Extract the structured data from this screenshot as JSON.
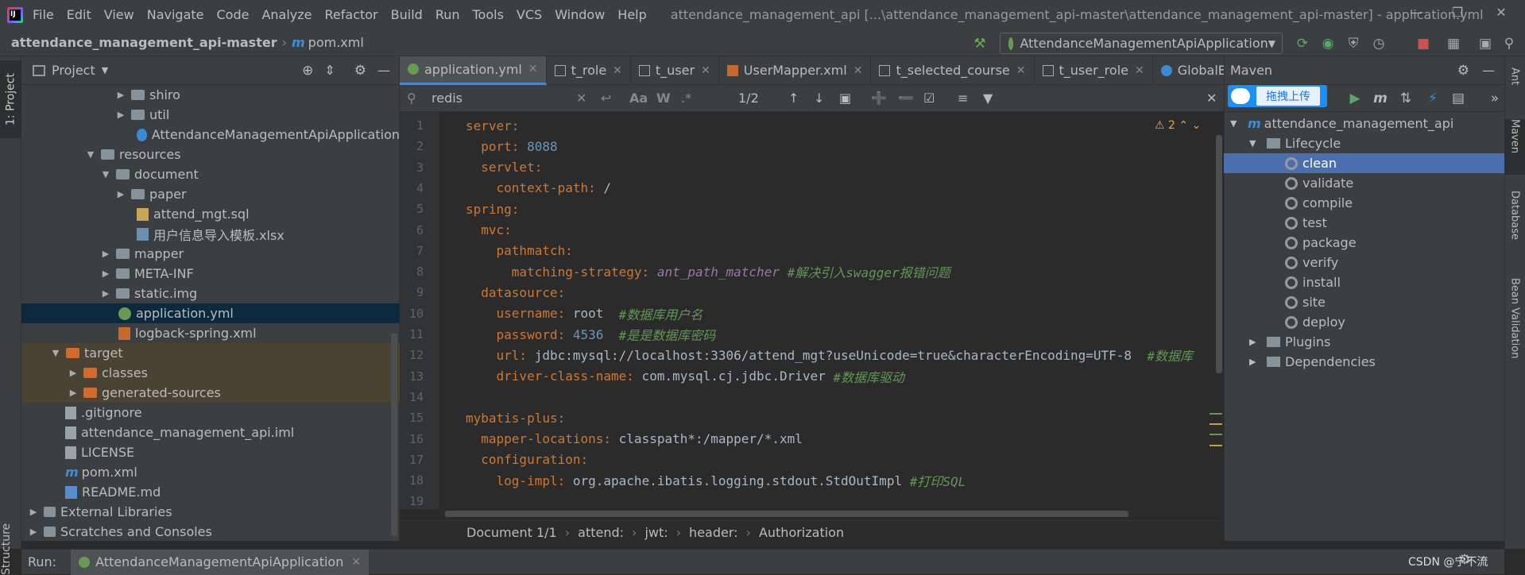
{
  "menubar": {
    "items": [
      "File",
      "Edit",
      "View",
      "Navigate",
      "Code",
      "Analyze",
      "Refactor",
      "Build",
      "Run",
      "Tools",
      "VCS",
      "Window",
      "Help"
    ],
    "window_title": "attendance_management_api [...\\attendance_management_api-master\\attendance_management_api-master] - application.yml"
  },
  "navbar": {
    "project": "attendance_management_api-master",
    "file": "pom.xml",
    "run_config": "AttendanceManagementApiApplication"
  },
  "project_panel": {
    "title": "Project",
    "tab_label": "1: Project",
    "structure_label": "Structure",
    "rows": [
      {
        "label": "shiro"
      },
      {
        "label": "util"
      },
      {
        "label": "AttendanceManagementApiApplication"
      },
      {
        "label": "resources"
      },
      {
        "label": "document"
      },
      {
        "label": "paper"
      },
      {
        "label": "attend_mgt.sql"
      },
      {
        "label": "用户信息导入模板.xlsx"
      },
      {
        "label": "mapper"
      },
      {
        "label": "META-INF"
      },
      {
        "label": "static.img"
      },
      {
        "label": "application.yml"
      },
      {
        "label": "logback-spring.xml"
      },
      {
        "label": "target"
      },
      {
        "label": "classes"
      },
      {
        "label": "generated-sources"
      },
      {
        "label": ".gitignore"
      },
      {
        "label": "attendance_management_api.iml"
      },
      {
        "label": "LICENSE"
      },
      {
        "label": "pom.xml"
      },
      {
        "label": "README.md"
      },
      {
        "label": "External Libraries"
      },
      {
        "label": "Scratches and Consoles"
      }
    ]
  },
  "editor_tabs": [
    {
      "label": "application.yml"
    },
    {
      "label": "t_role"
    },
    {
      "label": "t_user"
    },
    {
      "label": "UserMapper.xml"
    },
    {
      "label": "t_selected_course"
    },
    {
      "label": "t_user_role"
    },
    {
      "label": "GlobalE"
    }
  ],
  "search": {
    "query": "redis",
    "match_count": "1/2",
    "case_label": "Aa",
    "word_label": "W",
    "regex_label": ".*"
  },
  "editor": {
    "warning_count": "2",
    "lines": [
      {
        "n": "1",
        "key": "server:"
      },
      {
        "n": "2",
        "key": "  port:",
        "val": " 8088"
      },
      {
        "n": "3",
        "key": "  servlet:"
      },
      {
        "n": "4",
        "key": "    context-path:",
        "val": " /"
      },
      {
        "n": "5",
        "key": "spring:"
      },
      {
        "n": "6",
        "key": "  mvc:"
      },
      {
        "n": "7",
        "key": "    pathmatch:"
      },
      {
        "n": "8",
        "key": "      matching-strategy:",
        "val": " ",
        "italic": "ant_path_matcher",
        "comment": " #解决引入swagger报错问题"
      },
      {
        "n": "9",
        "key": "  datasource:"
      },
      {
        "n": "10",
        "key": "    username:",
        "val": " root  ",
        "comment": "#数据库用户名"
      },
      {
        "n": "11",
        "key": "    password:",
        "val": " 4536  ",
        "comment": "#是是数据库密码"
      },
      {
        "n": "12",
        "key": "    url:",
        "val": " jdbc:mysql://localhost:3306/attend_mgt?useUnicode=true&characterEncoding=UTF-8  ",
        "comment": "#数据库"
      },
      {
        "n": "13",
        "key": "    driver-class-name:",
        "val": " com.mysql.cj.jdbc.Driver ",
        "comment": "#数据库驱动"
      },
      {
        "n": "14",
        "key": ""
      },
      {
        "n": "15",
        "key": "mybatis-plus:"
      },
      {
        "n": "16",
        "key": "  mapper-locations:",
        "val": " classpath*:/mapper/*.xml"
      },
      {
        "n": "17",
        "key": "  configuration:"
      },
      {
        "n": "18",
        "key": "    log-impl:",
        "val": " org.apache.ibatis.logging.stdout.StdOutImpl ",
        "comment": "#打印SQL"
      },
      {
        "n": "19",
        "key": ""
      }
    ]
  },
  "breadcrumb": [
    "Document 1/1",
    "attend:",
    "jwt:",
    "header:",
    "Authorization"
  ],
  "maven": {
    "title": "Maven",
    "upload_label": "拖拽上传",
    "rows": [
      {
        "label": "attendance_management_api"
      },
      {
        "label": "Lifecycle"
      },
      {
        "label": "clean"
      },
      {
        "label": "validate"
      },
      {
        "label": "compile"
      },
      {
        "label": "test"
      },
      {
        "label": "package"
      },
      {
        "label": "verify"
      },
      {
        "label": "install"
      },
      {
        "label": "site"
      },
      {
        "label": "deploy"
      },
      {
        "label": "Plugins"
      },
      {
        "label": "Dependencies"
      }
    ]
  },
  "right_tabs": [
    "Ant",
    "Maven",
    "Database",
    "Bean Validation"
  ],
  "run_bar": {
    "label": "Run:",
    "tab": "AttendanceManagementApiApplication"
  },
  "watermark": "CSDN @宁不流"
}
